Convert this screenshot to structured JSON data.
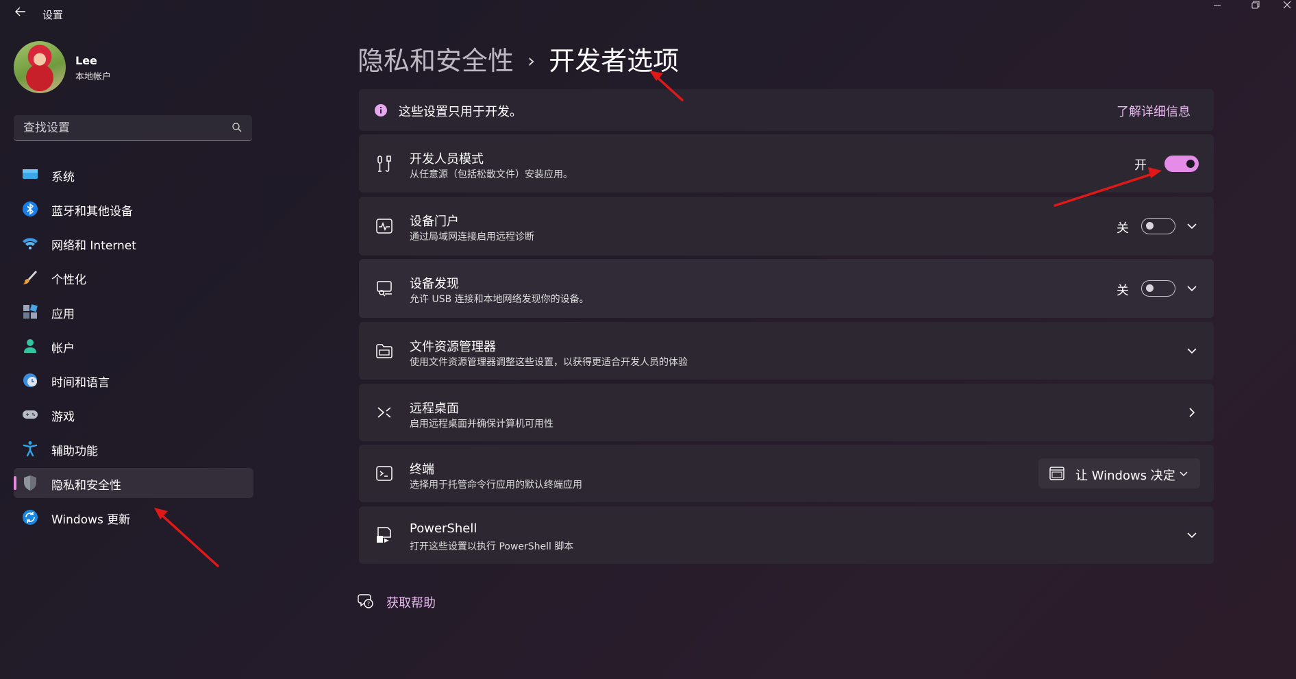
{
  "window": {
    "title": "设置",
    "back_icon": "arrow-left-icon",
    "controls": [
      "minimize-icon",
      "restore-icon",
      "close-icon"
    ]
  },
  "user": {
    "name": "Lee",
    "account_type": "本地帐户"
  },
  "search": {
    "placeholder": "查找设置",
    "value": ""
  },
  "sidebar": {
    "items": [
      {
        "label": "系统",
        "icon": "monitor-icon",
        "active": false
      },
      {
        "label": "蓝牙和其他设备",
        "icon": "bluetooth-icon",
        "active": false
      },
      {
        "label": "网络和 Internet",
        "icon": "wifi-icon",
        "active": false
      },
      {
        "label": "个性化",
        "icon": "brush-icon",
        "active": false
      },
      {
        "label": "应用",
        "icon": "apps-icon",
        "active": false
      },
      {
        "label": "帐户",
        "icon": "person-icon",
        "active": false
      },
      {
        "label": "时间和语言",
        "icon": "globe-clock-icon",
        "active": false
      },
      {
        "label": "游戏",
        "icon": "gamepad-icon",
        "active": false
      },
      {
        "label": "辅助功能",
        "icon": "accessibility-icon",
        "active": false
      },
      {
        "label": "隐私和安全性",
        "icon": "shield-icon",
        "active": true
      },
      {
        "label": "Windows 更新",
        "icon": "sync-icon",
        "active": false
      }
    ]
  },
  "breadcrumb": {
    "parent": "隐私和安全性",
    "separator": "›",
    "current": "开发者选项"
  },
  "info_bar": {
    "text": "这些设置只用于开发。",
    "link": "了解详细信息"
  },
  "settings": {
    "dev_mode": {
      "title": "开发人员模式",
      "subtitle": "从任意源（包括松散文件）安装应用。",
      "state": "开",
      "on": true
    },
    "device_portal": {
      "title": "设备门户",
      "subtitle": "通过局域网连接启用远程诊断",
      "state": "关",
      "on": false
    },
    "device_discovery": {
      "title": "设备发现",
      "subtitle": "允许 USB 连接和本地网络发现你的设备。",
      "state": "关",
      "on": false
    },
    "file_explorer": {
      "title": "文件资源管理器",
      "subtitle": "使用文件资源管理器调整这些设置，以获得更适合开发人员的体验"
    },
    "remote_desktop": {
      "title": "远程桌面",
      "subtitle": "启用远程桌面并确保计算机可用性"
    },
    "terminal": {
      "title": "终端",
      "subtitle": "选择用于托管命令行应用的默认终端应用",
      "dropdown_value": "让 Windows 决定"
    },
    "powershell": {
      "title": "PowerShell",
      "subtitle": "打开这些设置以执行 PowerShell 脚本"
    }
  },
  "help": {
    "label": "获取帮助"
  },
  "colors": {
    "accent": "#e48ce8",
    "link": "#e8b8f0",
    "annotation_arrow": "#e01818"
  }
}
